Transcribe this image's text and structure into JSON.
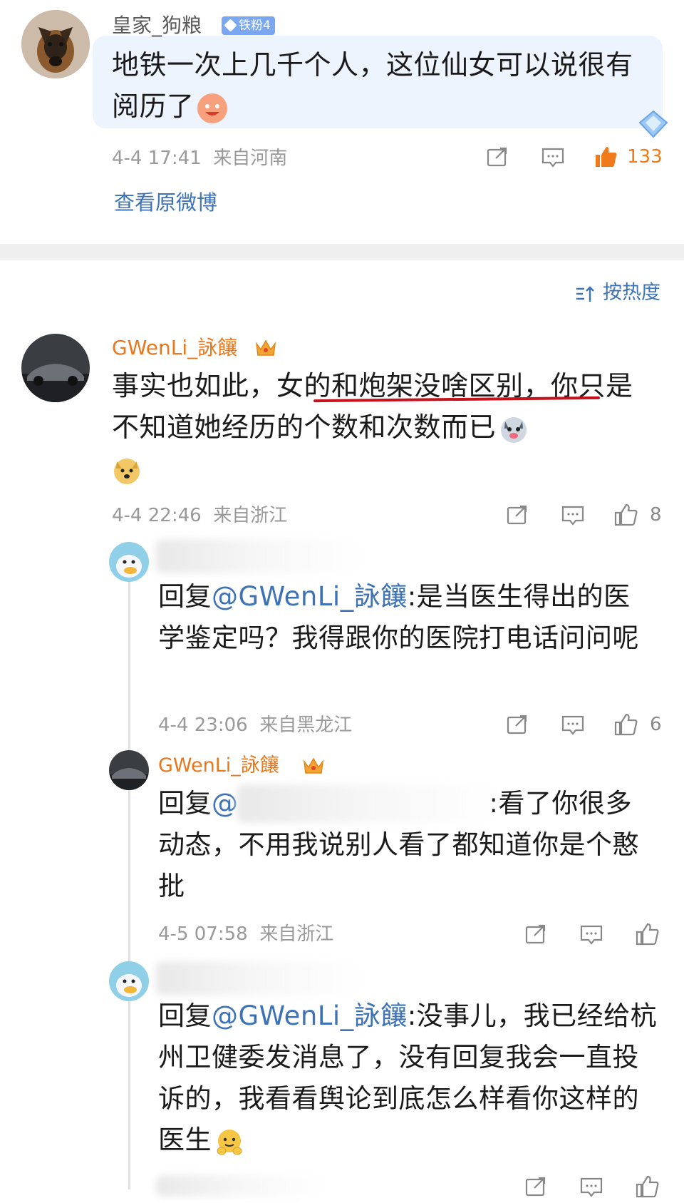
{
  "top_comment": {
    "username": "皇家_狗粮",
    "fan_badge": "铁粉4",
    "text": "地铁一次上几千个人，这位仙女可以说很有阅历了",
    "time": "4-4 17:41",
    "location": "来自河南",
    "likes": "133",
    "view_original": "查看原微博"
  },
  "sort_label": "按热度",
  "main_comment": {
    "username": "GWenLi_詠饟",
    "text_before": "事实也如此，",
    "text_underlined": "女的和炮架没啥区别，",
    "text_after": "你只是不知道她经历的个数和次数而已",
    "time": "4-4 22:46",
    "location": "来自浙江",
    "likes": "8"
  },
  "replies": [
    {
      "reply_prefix": "回复",
      "mention": "@GWenLi_詠饟",
      "text": ":是当医生得出的医学鉴定吗？我得跟你的医院打电话问问呢",
      "time": "4-4 23:06",
      "location": "来自黑龙江",
      "likes": "6"
    },
    {
      "username": "GWenLi_詠饟",
      "reply_prefix": "回复",
      "mention": "@",
      "text": ":看了你很多动态，不用我说别人看了都知道你是个憨批",
      "time": "4-5 07:58",
      "location": "来自浙江",
      "likes": ""
    },
    {
      "reply_prefix": "回复",
      "mention": "@GWenLi_詠饟",
      "text": ":没事儿，我已经给杭州卫健委发消息了，没有回复我会一直投诉的，我看看舆论到底怎么样看你这样的医生",
      "time": "",
      "location": "",
      "likes": ""
    }
  ],
  "colors": {
    "mention": "#3d73b6",
    "orange_name": "#e8771e",
    "hot_like": "#f07b1a",
    "underline": "#c4131c"
  },
  "icons": [
    "share-icon",
    "comment-icon",
    "like-icon",
    "sort-icon",
    "crown-icon",
    "diamond-icon"
  ]
}
